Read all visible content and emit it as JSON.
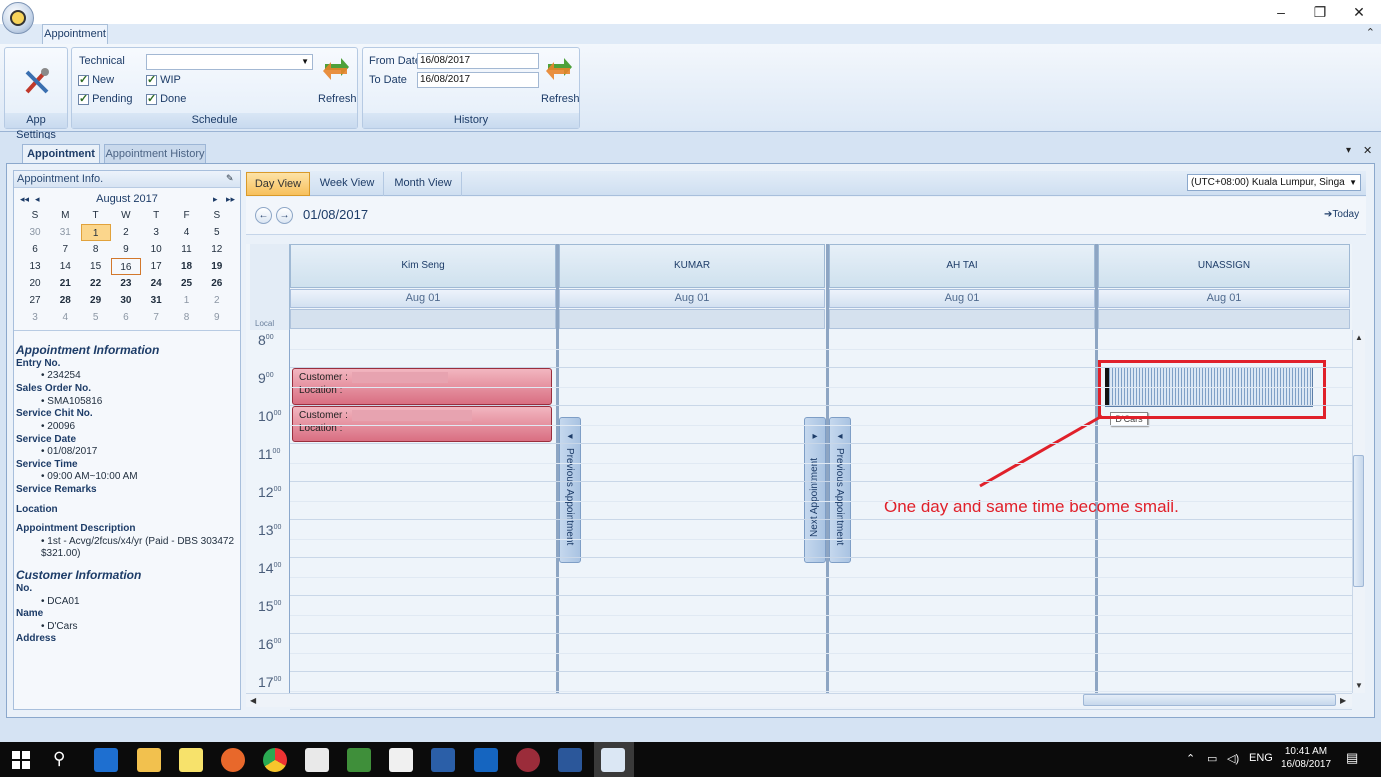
{
  "window": {
    "minimize": "–",
    "restore": "❐",
    "close": "✕"
  },
  "ribbon": {
    "tab_label": "Appointment",
    "collapse": "⌃",
    "app_settings_label": "App Settings",
    "schedule": {
      "technical_label": "Technical",
      "technical_value": "",
      "checks": [
        {
          "label": "New",
          "checked": true
        },
        {
          "label": "WIP",
          "checked": true
        },
        {
          "label": "Pending",
          "checked": true
        },
        {
          "label": "Done",
          "checked": true
        }
      ],
      "refresh_label": "Refresh",
      "group_label": "Schedule"
    },
    "history": {
      "from_label": "From Date",
      "from_value": "16/08/2017",
      "to_label": "To Date",
      "to_value": "16/08/2017",
      "refresh_label": "Refresh",
      "group_label": "History"
    }
  },
  "doc_tabs": [
    {
      "label": "Appointment",
      "active": true
    },
    {
      "label": "Appointment History",
      "active": false
    }
  ],
  "doc_controls": {
    "dropdown": "▾",
    "close": "✕"
  },
  "left_panel": {
    "header": "Appointment Info.",
    "pin": "📌",
    "calendar": {
      "month_label": "August 2017",
      "nav": {
        "first": "◂◂",
        "prev": "◂",
        "next": "▸",
        "last": "▸▸"
      },
      "weekdays": [
        "S",
        "M",
        "T",
        "W",
        "T",
        "F",
        "S"
      ],
      "weeks": [
        [
          {
            "d": "30",
            "dim": true
          },
          {
            "d": "31",
            "dim": true
          },
          {
            "d": "1",
            "sel": true
          },
          {
            "d": "2"
          },
          {
            "d": "3"
          },
          {
            "d": "4"
          },
          {
            "d": "5"
          }
        ],
        [
          {
            "d": "6"
          },
          {
            "d": "7"
          },
          {
            "d": "8"
          },
          {
            "d": "9"
          },
          {
            "d": "10"
          },
          {
            "d": "11"
          },
          {
            "d": "12"
          }
        ],
        [
          {
            "d": "13"
          },
          {
            "d": "14"
          },
          {
            "d": "15"
          },
          {
            "d": "16",
            "today": true
          },
          {
            "d": "17"
          },
          {
            "d": "18",
            "bold": true
          },
          {
            "d": "19",
            "bold": true
          }
        ],
        [
          {
            "d": "20"
          },
          {
            "d": "21",
            "bold": true
          },
          {
            "d": "22",
            "bold": true
          },
          {
            "d": "23",
            "bold": true
          },
          {
            "d": "24",
            "bold": true
          },
          {
            "d": "25",
            "bold": true
          },
          {
            "d": "26",
            "bold": true
          }
        ],
        [
          {
            "d": "27"
          },
          {
            "d": "28",
            "bold": true
          },
          {
            "d": "29",
            "bold": true
          },
          {
            "d": "30",
            "bold": true
          },
          {
            "d": "31",
            "bold": true
          },
          {
            "d": "1",
            "dim": true
          },
          {
            "d": "2",
            "dim": true
          }
        ],
        [
          {
            "d": "3",
            "dim": true
          },
          {
            "d": "4",
            "dim": true
          },
          {
            "d": "5",
            "dim": true
          },
          {
            "d": "6",
            "dim": true
          },
          {
            "d": "7",
            "dim": true
          },
          {
            "d": "8",
            "dim": true
          },
          {
            "d": "9",
            "dim": true
          }
        ]
      ]
    },
    "appointment_info": {
      "title": "Appointment Information",
      "entry_no_label": "Entry No.",
      "entry_no": "234254",
      "sales_order_label": "Sales Order No.",
      "sales_order": "SMA105816",
      "chit_label": "Service Chit No.",
      "chit": "20096",
      "date_label": "Service Date",
      "date": "01/08/2017",
      "time_label": "Service Time",
      "time": "09:00 AM~10:00 AM",
      "remarks_label": "Service Remarks",
      "location_label": "Location",
      "desc_label": "Appointment Description",
      "desc_line1": "1st - Acvg/2fcus/x4/yr (Paid - DBS 303472",
      "desc_line2": "$321.00)"
    },
    "customer_info": {
      "title": "Customer Information",
      "no_label": "No.",
      "no": "DCA01",
      "name_label": "Name",
      "name": "D'Cars",
      "address_label": "Address"
    }
  },
  "scheduler": {
    "views": [
      {
        "label": "Day View",
        "active": true
      },
      {
        "label": "Week View",
        "active": false
      },
      {
        "label": "Month View",
        "active": false
      }
    ],
    "timezone": "(UTC+08:00) Kuala Lumpur, Singa",
    "nav_prev": "←",
    "nav_next": "→",
    "current_date": "01/08/2017",
    "today_label": "Today",
    "today_arrow": "➔",
    "local_label": "Local",
    "resources": [
      "Kim Seng",
      "KUMAR",
      "AH TAI",
      "UNASSIGN"
    ],
    "day_label": "Aug 01",
    "hours": [
      "8",
      "9",
      "10",
      "11",
      "12",
      "13",
      "14",
      "15",
      "16",
      "17"
    ],
    "minute_suffix": "00",
    "appointments": [
      {
        "customer_label": "Customer :",
        "location_label": "Location :"
      },
      {
        "customer_label": "Customer :",
        "location_label": "Location :"
      }
    ],
    "prev_appt_label": "Previous Appointment",
    "next_appt_label": "Next Appointment",
    "tooltip": "D'Cars",
    "annotation": "One day and same time become small.",
    "annotation_color": "#e0202a"
  },
  "taskbar": {
    "lang": "ENG",
    "time": "10:41 AM",
    "date": "16/08/2017",
    "tray_up": "⌃",
    "notification": "▤"
  }
}
